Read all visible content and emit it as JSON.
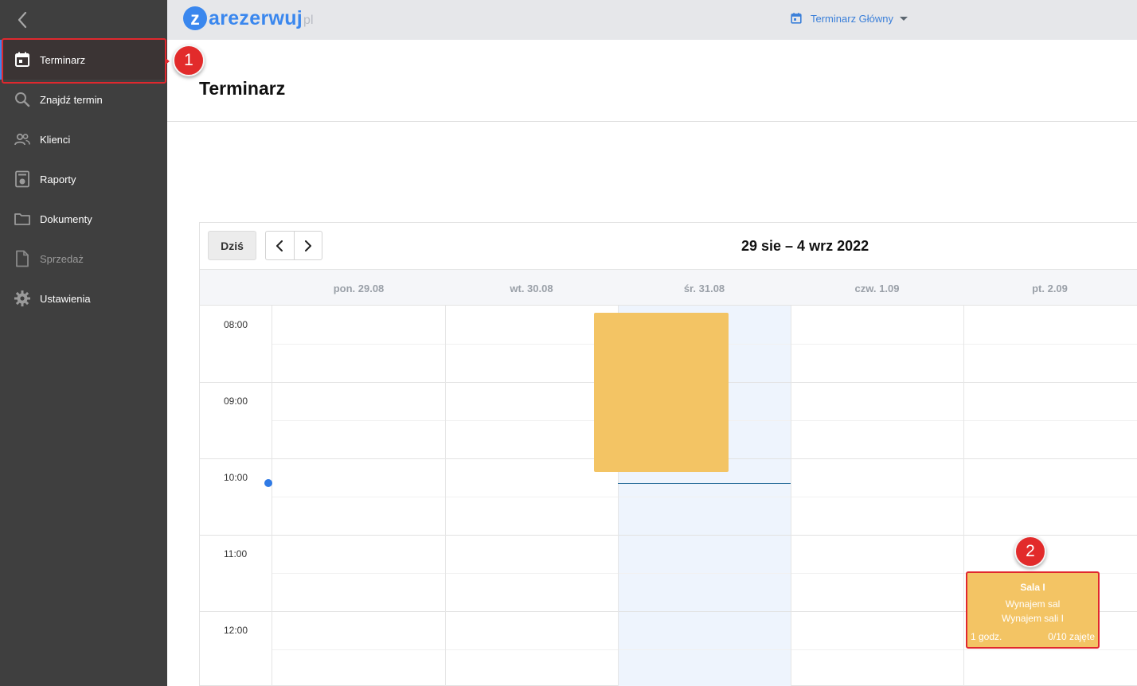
{
  "sidebar": {
    "items": [
      {
        "label": "Terminarz",
        "icon": "calendar-icon",
        "active": true
      },
      {
        "label": "Znajdź termin",
        "icon": "search-icon"
      },
      {
        "label": "Klienci",
        "icon": "people-icon"
      },
      {
        "label": "Raporty",
        "icon": "report-icon"
      },
      {
        "label": "Dokumenty",
        "icon": "folder-icon"
      },
      {
        "label": "Sprzedaż",
        "icon": "document-icon",
        "disabled": true
      },
      {
        "label": "Ustawienia",
        "icon": "gear-icon"
      }
    ]
  },
  "annotations": {
    "marker1": "1",
    "marker2": "2"
  },
  "header": {
    "logo": {
      "letter": "z",
      "text": "arezerwuj",
      "tld": "pl"
    },
    "calendar_select": "Terminarz Główny"
  },
  "page": {
    "title": "Terminarz"
  },
  "calendar": {
    "today_button": "Dziś",
    "range": "29 sie – 4 wrz 2022",
    "days": [
      "pon. 29.08",
      "wt. 30.08",
      "śr. 31.08",
      "czw. 1.09",
      "pt. 2.09"
    ],
    "hours": [
      "08:00",
      "09:00",
      "10:00",
      "11:00",
      "12:00"
    ],
    "event": {
      "title": "Sala I",
      "line1": "Wynajem sal",
      "line2": "Wynajem sali I",
      "duration": "1 godz.",
      "capacity": "0/10 zajęte"
    }
  },
  "colors": {
    "sidebar_bg": "#3f3f3f",
    "accent": "#3a87ee",
    "event": "#f3c464",
    "highlight": "#e0282e",
    "today_col": "#eef4fd"
  }
}
